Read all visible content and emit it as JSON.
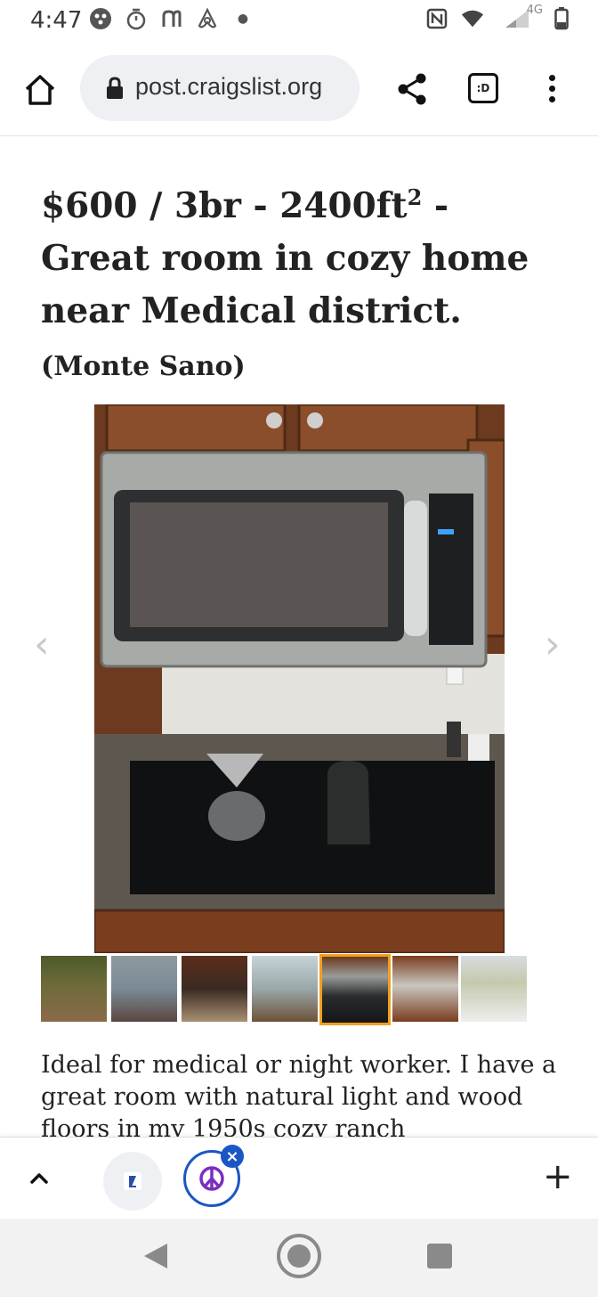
{
  "status_bar": {
    "time": "4:47",
    "network_label": "4G",
    "icons": [
      "ovr-icon",
      "stopwatch-icon",
      "n-app-icon",
      "airbnb-icon",
      "dot-icon",
      "nfc-icon",
      "wifi-icon",
      "signal-icon",
      "battery-icon"
    ]
  },
  "browser": {
    "url": "post.craigslist.org",
    "tabs_label": ":D",
    "icons": [
      "home-icon",
      "lock-icon",
      "share-icon",
      "tabs-icon",
      "more-icon"
    ]
  },
  "post": {
    "title_main": "$600 / 3br - 2400ft",
    "title_sup": "2",
    "title_rest": " - Great room in cozy home near Medical district.",
    "title_area": "(Monte Sano)",
    "prev_arrow": "‹",
    "next_arrow": "›",
    "thumbnail_count": 7,
    "selected_thumbnail": 5,
    "body": "Ideal for medical or night worker. I have a great room with natural light and wood floors in my 1950s cozy ranch"
  },
  "tab_strip": {
    "close_label": "×",
    "new_tab_label": "+",
    "icons": [
      "chevron-up-icon",
      "tab-favicon-icon",
      "peace-sign-icon",
      "close-icon",
      "plus-icon"
    ]
  },
  "nav_bar": {
    "icons": [
      "back-icon",
      "home-circle-icon",
      "recents-icon"
    ]
  },
  "colors": {
    "accent_blue": "#1a56c4",
    "thumbnail_selected": "#f0a020",
    "url_pill": "#eef0f3"
  }
}
